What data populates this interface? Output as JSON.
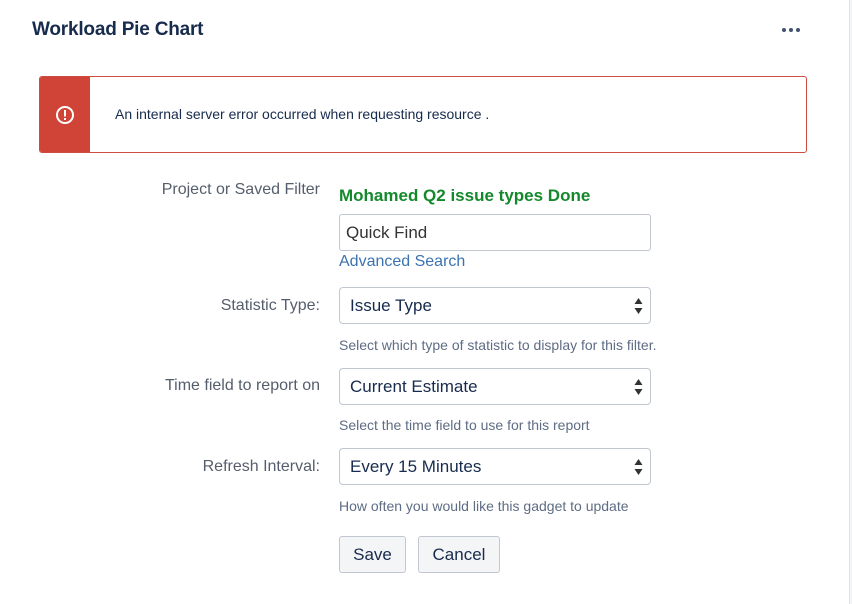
{
  "gadget": {
    "title": "Workload Pie Chart"
  },
  "error": {
    "message": "An internal server error occurred when requesting resource ."
  },
  "form": {
    "project_filter": {
      "label": "Project or Saved Filter",
      "selected": "Mohamed Q2 issue types Done",
      "quick_find_placeholder": "Quick Find",
      "advanced_search": "Advanced Search"
    },
    "statistic_type": {
      "label": "Statistic Type:",
      "value": "Issue Type",
      "help": "Select which type of statistic to display for this filter."
    },
    "time_field": {
      "label": "Time field to report on",
      "value": "Current Estimate",
      "help": "Select the time field to use for this report"
    },
    "refresh_interval": {
      "label": "Refresh Interval:",
      "value": "Every 15 Minutes",
      "help": "How often you would like this gadget to update"
    },
    "save_label": "Save",
    "cancel_label": "Cancel"
  },
  "colors": {
    "error_red": "#d04437",
    "success_green": "#14892c",
    "link_blue": "#3b73af"
  }
}
